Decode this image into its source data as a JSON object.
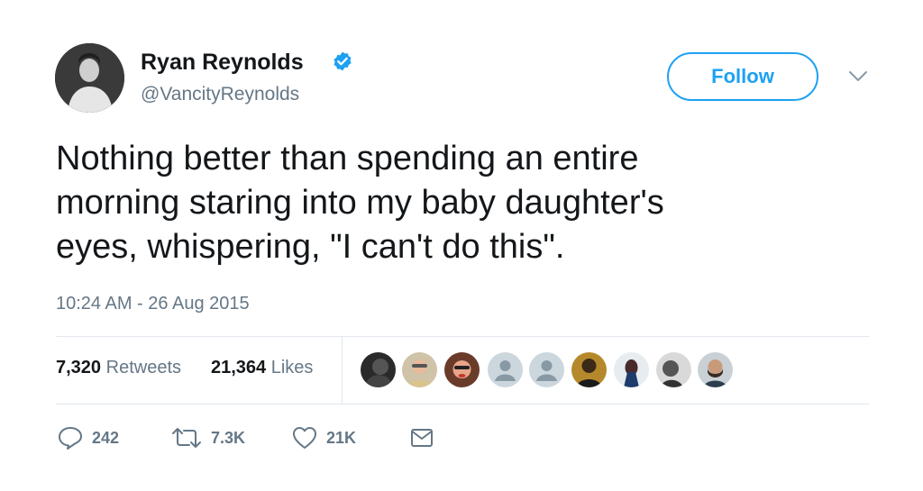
{
  "profile": {
    "display_name": "Ryan Reynolds",
    "handle": "@VancityReynolds",
    "verified_icon": "verified-badge-icon"
  },
  "header": {
    "follow_label": "Follow",
    "menu_icon": "chevron-down-icon"
  },
  "tweet": {
    "text_lines": [
      "Nothing better than spending an entire",
      "morning staring into my baby daughter's",
      "eyes, whispering, \"I can't do this\"."
    ],
    "timestamp": "10:24 AM - 26 Aug 2015"
  },
  "stats": {
    "retweets_count": "7,320",
    "retweets_label": "Retweets",
    "likes_count": "21,364",
    "likes_label": "Likes"
  },
  "liked_by_avatars": [
    "avatar-1",
    "avatar-2",
    "avatar-3",
    "avatar-4",
    "avatar-5",
    "avatar-6",
    "avatar-7",
    "avatar-8",
    "avatar-9"
  ],
  "actions": {
    "reply_count": "242",
    "retweet_count": "7.3K",
    "like_count": "21K"
  },
  "colors": {
    "accent": "#1da1f2",
    "text": "#14171a",
    "muted": "#657786",
    "divider": "#e1e8ed"
  }
}
